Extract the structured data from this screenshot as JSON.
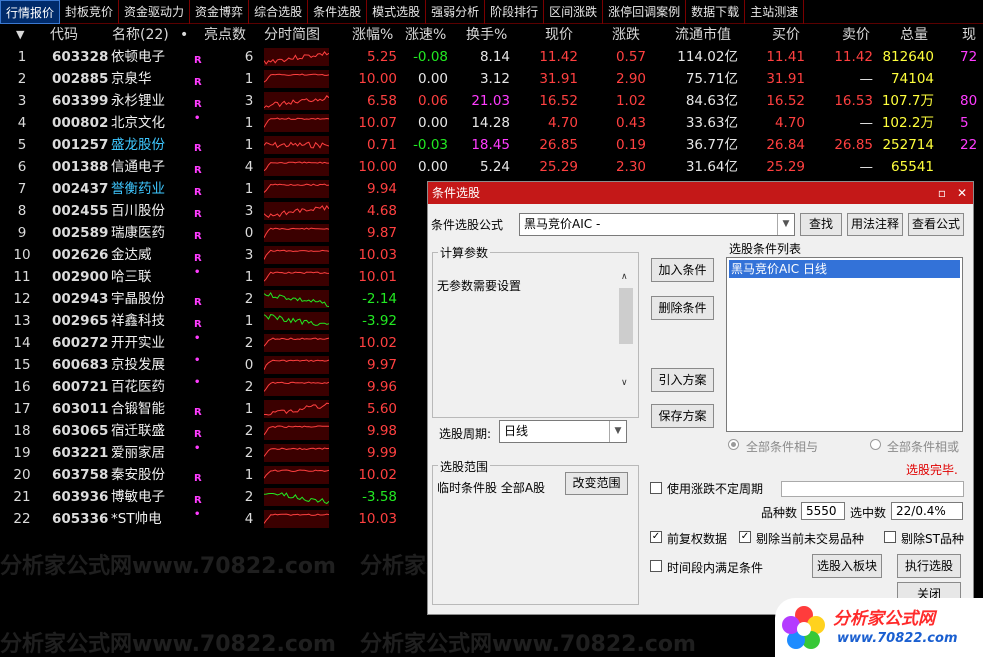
{
  "tabs": [
    {
      "label": "行情报价",
      "active": true
    },
    {
      "label": "封板竞价"
    },
    {
      "label": "资金驱动力"
    },
    {
      "label": "资金博弈"
    },
    {
      "label": "综合选股"
    },
    {
      "label": "条件选股"
    },
    {
      "label": "模式选股"
    },
    {
      "label": "强弱分析"
    },
    {
      "label": "阶段排行"
    },
    {
      "label": "区间涨跌"
    },
    {
      "label": "涨停回调案例"
    },
    {
      "label": "数据下载"
    },
    {
      "label": "主站测速"
    }
  ],
  "table": {
    "headers": {
      "sort": "▼",
      "code": "代码",
      "name": "名称(22)",
      "dot": "•",
      "count": "亮点数",
      "chart": "分时简图",
      "chg": "涨幅%",
      "speed": "涨速%",
      "turnover": "换手%",
      "price": "现价",
      "diff": "涨跌",
      "mcap": "流通市值",
      "bid": "买价",
      "ask": "卖价",
      "vol": "总量",
      "cur": "现"
    },
    "rows": [
      {
        "n": "1",
        "code": "603328",
        "name": "依顿电子",
        "r": "R",
        "cnt": "6",
        "chg": "5.25",
        "speed": "-0.08",
        "turn": "8.14",
        "price": "11.42",
        "diff": "0.57",
        "mcap": "114.02亿",
        "bid": "11.41",
        "ask": "11.42",
        "vol": "812640",
        "cur": "72",
        "hl": false,
        "trend": "up"
      },
      {
        "n": "2",
        "code": "002885",
        "name": "京泉华",
        "r": "R",
        "cnt": "1",
        "chg": "10.00",
        "speed": "0.00",
        "turn": "3.12",
        "price": "31.91",
        "diff": "2.90",
        "mcap": "75.71亿",
        "bid": "31.91",
        "ask": "—",
        "vol": "74104",
        "cur": "",
        "hl": false,
        "trend": "limit"
      },
      {
        "n": "3",
        "code": "603399",
        "name": "永杉锂业",
        "r": "R",
        "cnt": "3",
        "chg": "6.58",
        "speed": "0.06",
        "turn": "21.03",
        "price": "16.52",
        "diff": "1.02",
        "mcap": "84.63亿",
        "bid": "16.52",
        "ask": "16.53",
        "vol": "107.7万",
        "cur": "80",
        "hl": false,
        "trend": "up"
      },
      {
        "n": "4",
        "code": "000802",
        "name": "北京文化",
        "r": "",
        "cnt": "1",
        "chg": "10.07",
        "speed": "0.00",
        "turn": "14.28",
        "price": "4.70",
        "diff": "0.43",
        "mcap": "33.63亿",
        "bid": "4.70",
        "ask": "—",
        "vol": "102.2万",
        "cur": "5",
        "hl": false,
        "trend": "limit"
      },
      {
        "n": "5",
        "code": "001257",
        "name": "盛龙股份",
        "r": "R",
        "cnt": "1",
        "chg": "0.71",
        "speed": "-0.03",
        "turn": "18.45",
        "price": "26.85",
        "diff": "0.19",
        "mcap": "36.77亿",
        "bid": "26.84",
        "ask": "26.85",
        "vol": "252714",
        "cur": "22",
        "hl": true,
        "trend": "flat"
      },
      {
        "n": "6",
        "code": "001388",
        "name": "信通电子",
        "r": "R",
        "cnt": "4",
        "chg": "10.00",
        "speed": "0.00",
        "turn": "5.24",
        "price": "25.29",
        "diff": "2.30",
        "mcap": "31.64亿",
        "bid": "25.29",
        "ask": "—",
        "vol": "65541",
        "cur": "",
        "hl": false,
        "trend": "limit"
      },
      {
        "n": "7",
        "code": "002437",
        "name": "誉衡药业",
        "r": "R",
        "cnt": "1",
        "chg": "9.94",
        "hl": true,
        "trend": "limit"
      },
      {
        "n": "8",
        "code": "002455",
        "name": "百川股份",
        "r": "R",
        "cnt": "3",
        "chg": "4.68",
        "hl": false,
        "trend": "up"
      },
      {
        "n": "9",
        "code": "002589",
        "name": "瑞康医药",
        "r": "R",
        "cnt": "0",
        "chg": "9.87",
        "hl": false,
        "trend": "limit"
      },
      {
        "n": "10",
        "code": "002626",
        "name": "金达威",
        "r": "R",
        "cnt": "3",
        "chg": "10.03",
        "hl": false,
        "trend": "limit"
      },
      {
        "n": "11",
        "code": "002900",
        "name": "哈三联",
        "r": "",
        "cnt": "1",
        "chg": "10.01",
        "hl": false,
        "trend": "limit"
      },
      {
        "n": "12",
        "code": "002943",
        "name": "宇晶股份",
        "r": "R",
        "cnt": "2",
        "chg": "-2.14",
        "hl": false,
        "trend": "down"
      },
      {
        "n": "13",
        "code": "002965",
        "name": "祥鑫科技",
        "r": "R",
        "cnt": "1",
        "chg": "-3.92",
        "hl": false,
        "trend": "down"
      },
      {
        "n": "14",
        "code": "600272",
        "name": "开开实业",
        "r": "",
        "cnt": "2",
        "chg": "10.02",
        "hl": false,
        "trend": "limit"
      },
      {
        "n": "15",
        "code": "600683",
        "name": "京投发展",
        "r": "",
        "cnt": "0",
        "chg": "9.97",
        "hl": false,
        "trend": "limit"
      },
      {
        "n": "16",
        "code": "600721",
        "name": "百花医药",
        "r": "",
        "cnt": "2",
        "chg": "9.96",
        "hl": false,
        "trend": "limit"
      },
      {
        "n": "17",
        "code": "603011",
        "name": "合锻智能",
        "r": "R",
        "cnt": "1",
        "chg": "5.60",
        "hl": false,
        "trend": "up"
      },
      {
        "n": "18",
        "code": "603065",
        "name": "宿迁联盛",
        "r": "R",
        "cnt": "2",
        "chg": "9.98",
        "hl": false,
        "trend": "limit"
      },
      {
        "n": "19",
        "code": "603221",
        "name": "爱丽家居",
        "r": "",
        "cnt": "2",
        "chg": "9.99",
        "hl": false,
        "trend": "limit"
      },
      {
        "n": "20",
        "code": "603758",
        "name": "秦安股份",
        "r": "R",
        "cnt": "1",
        "chg": "10.02",
        "hl": false,
        "trend": "limit"
      },
      {
        "n": "21",
        "code": "603936",
        "name": "博敏电子",
        "r": "R",
        "cnt": "2",
        "chg": "-3.58",
        "hl": false,
        "trend": "down"
      },
      {
        "n": "22",
        "code": "605336",
        "name": "*ST帅电",
        "r": "",
        "cnt": "4",
        "chg": "10.03",
        "hl": false,
        "trend": "limit"
      }
    ]
  },
  "dialog": {
    "title": "条件选股",
    "formula_label": "条件选股公式",
    "formula_value": "黑马竞价AIC  -",
    "btn_find": "查找",
    "btn_usage": "用法注释",
    "btn_view": "查看公式",
    "params_label": "计算参数",
    "params_text": "无参数需要设置",
    "btn_add": "加入条件",
    "btn_delete": "删除条件",
    "btn_import": "引入方案",
    "btn_save": "保存方案",
    "list_label": "选股条件列表",
    "list_items": [
      "黑马竞价AIC  日线"
    ],
    "period_label": "选股周期:",
    "period_value": "日线",
    "radio_and": "全部条件相与",
    "radio_or": "全部条件相或",
    "range_label": "选股范围",
    "range_text": "临时条件股 全部A股",
    "btn_change_range": "改变范围",
    "status": "选股完毕.",
    "chk_indefinite": "使用涨跌不定周期",
    "count_label": "品种数",
    "count_value": "5550",
    "selected_label": "选中数",
    "selected_value": "22/0.4%",
    "chk_restore": "前复权数据",
    "chk_exclude_untraded": "剔除当前未交易品种",
    "chk_exclude_st": "剔除ST品种",
    "chk_period_satisfy": "时间段内满足条件",
    "btn_to_block": "选股入板块",
    "btn_execute": "执行选股",
    "btn_close": "关闭",
    "close_glyph": "✕",
    "min_glyph": "▫"
  },
  "logo": {
    "title": "分析家公式网",
    "url": "www.70822.com"
  },
  "watermark": "分析家公式网www.70822.com",
  "colors": {
    "up": "#ff4040",
    "down": "#22e822",
    "title_bar": "#c41818",
    "highlight_name": "#3ec7ff"
  }
}
